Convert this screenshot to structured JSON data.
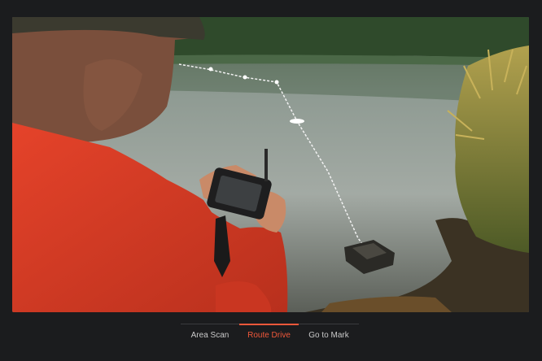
{
  "hero": {
    "alt": "Person operating a bait boat by remote control at a lake shore",
    "route_marker": "",
    "colors": {
      "route_line": "#f2f2f2",
      "jacket": "#e8492f",
      "water": "#8c9690",
      "forest": "#2e4a2a"
    }
  },
  "tabs": {
    "items": [
      {
        "label": "Area Scan",
        "active": false
      },
      {
        "label": "Route Drive",
        "active": true
      },
      {
        "label": "Go to Mark",
        "active": false
      }
    ],
    "accent": "#f0583a"
  }
}
